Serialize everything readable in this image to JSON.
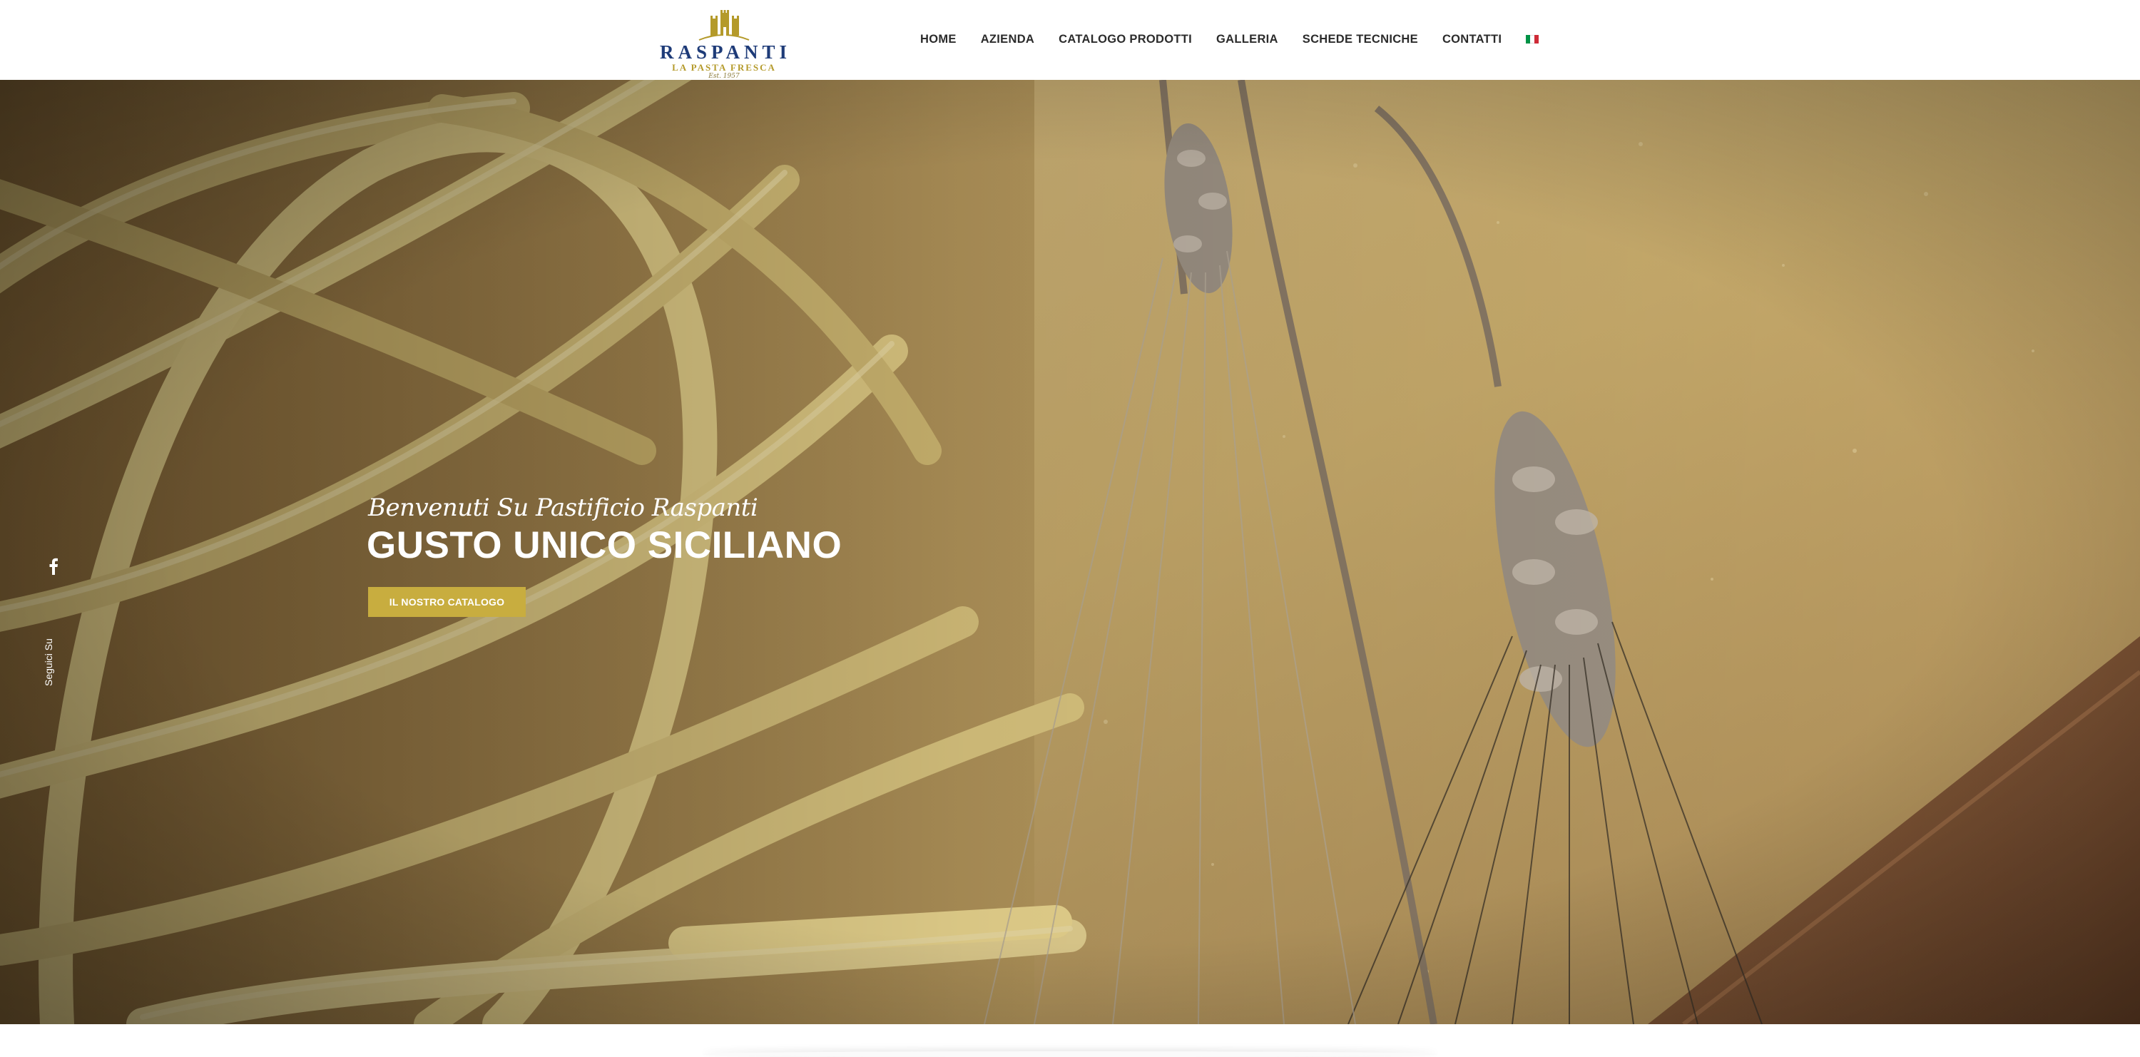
{
  "brand": {
    "name": "RASPANTI",
    "tagline": "LA PASTA FRESCA",
    "established": "Est. 1957"
  },
  "nav": {
    "items": [
      {
        "label": "HOME"
      },
      {
        "label": "AZIENDA"
      },
      {
        "label": "CATALOGO PRODOTTI"
      },
      {
        "label": "GALLERIA"
      },
      {
        "label": "SCHEDE TECNICHE"
      },
      {
        "label": "CONTATTI"
      }
    ],
    "language_flag": "italian-flag-icon"
  },
  "hero": {
    "script_text": "Benvenuti Su Pastificio Raspanti",
    "title": "GUSTO UNICO SICILIANO",
    "cta_label": "IL NOSTRO CATALOGO"
  },
  "social": {
    "label": "Seguici Su",
    "icon": "facebook-icon"
  },
  "colors": {
    "brand_blue": "#1e3b78",
    "brand_gold": "#b49a2a",
    "cta_gold": "#c8ad3f"
  }
}
